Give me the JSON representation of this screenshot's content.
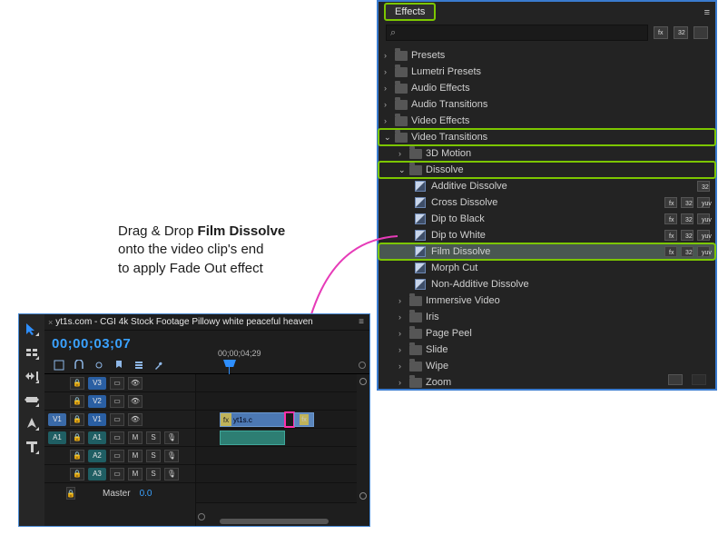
{
  "instruction": {
    "line1_pre": "Drag & Drop ",
    "line1_bold": "Film Dissolve",
    "line2": "onto the video clip's end",
    "line3": "to apply Fade Out effect"
  },
  "effects_panel": {
    "tab_label": "Effects",
    "search_placeholder": "",
    "tree": [
      {
        "type": "folder",
        "label": "Presets",
        "expanded": false,
        "indent": 0,
        "highlight": false,
        "badges": []
      },
      {
        "type": "folder",
        "label": "Lumetri Presets",
        "expanded": false,
        "indent": 0,
        "highlight": false,
        "badges": []
      },
      {
        "type": "folder",
        "label": "Audio Effects",
        "expanded": false,
        "indent": 0,
        "highlight": false,
        "badges": []
      },
      {
        "type": "folder",
        "label": "Audio Transitions",
        "expanded": false,
        "indent": 0,
        "highlight": false,
        "badges": []
      },
      {
        "type": "folder",
        "label": "Video Effects",
        "expanded": false,
        "indent": 0,
        "highlight": false,
        "badges": []
      },
      {
        "type": "folder",
        "label": "Video Transitions",
        "expanded": true,
        "indent": 0,
        "highlight": true,
        "badges": []
      },
      {
        "type": "folder",
        "label": "3D Motion",
        "expanded": false,
        "indent": 1,
        "highlight": false,
        "badges": []
      },
      {
        "type": "folder",
        "label": "Dissolve",
        "expanded": true,
        "indent": 1,
        "highlight": true,
        "badges": []
      },
      {
        "type": "effect",
        "label": "Additive Dissolve",
        "indent": 2,
        "highlight": false,
        "selected": false,
        "badges": [
          "32"
        ]
      },
      {
        "type": "effect",
        "label": "Cross Dissolve",
        "indent": 2,
        "highlight": false,
        "selected": false,
        "badges": [
          "fx",
          "32",
          "yuv"
        ]
      },
      {
        "type": "effect",
        "label": "Dip to Black",
        "indent": 2,
        "highlight": false,
        "selected": false,
        "badges": [
          "fx",
          "32",
          "yuv"
        ]
      },
      {
        "type": "effect",
        "label": "Dip to White",
        "indent": 2,
        "highlight": false,
        "selected": false,
        "badges": [
          "fx",
          "32",
          "yuv"
        ]
      },
      {
        "type": "effect",
        "label": "Film Dissolve",
        "indent": 2,
        "highlight": true,
        "selected": true,
        "badges": [
          "fx",
          "32",
          "yuv"
        ]
      },
      {
        "type": "effect",
        "label": "Morph Cut",
        "indent": 2,
        "highlight": false,
        "selected": false,
        "badges": []
      },
      {
        "type": "effect",
        "label": "Non-Additive Dissolve",
        "indent": 2,
        "highlight": false,
        "selected": false,
        "badges": []
      },
      {
        "type": "folder",
        "label": "Immersive Video",
        "expanded": false,
        "indent": 1,
        "highlight": false,
        "badges": []
      },
      {
        "type": "folder",
        "label": "Iris",
        "expanded": false,
        "indent": 1,
        "highlight": false,
        "badges": []
      },
      {
        "type": "folder",
        "label": "Page Peel",
        "expanded": false,
        "indent": 1,
        "highlight": false,
        "badges": []
      },
      {
        "type": "folder",
        "label": "Slide",
        "expanded": false,
        "indent": 1,
        "highlight": false,
        "badges": []
      },
      {
        "type": "folder",
        "label": "Wipe",
        "expanded": false,
        "indent": 1,
        "highlight": false,
        "badges": []
      },
      {
        "type": "folder",
        "label": "Zoom",
        "expanded": false,
        "indent": 1,
        "highlight": false,
        "badges": []
      }
    ]
  },
  "timeline": {
    "sequence_tab": "yt1s.com - CGI 4k Stock Footage  Pillowy white peaceful heaven",
    "timecode": "00;00;03;07",
    "ruler_mark": "00;00;04;29",
    "tools": [
      "selection",
      "track-select",
      "ripple",
      "razor",
      "slip",
      "pen",
      "hand",
      "type"
    ],
    "option_icons": [
      "nest",
      "snap",
      "linked",
      "markers",
      "settings",
      "wrench"
    ],
    "video_tracks": [
      "V3",
      "V2",
      "V1"
    ],
    "audio_tracks": [
      "A1",
      "A2",
      "A3"
    ],
    "source_v": "V1",
    "source_a": "A1",
    "mute": "M",
    "solo": "S",
    "clip_label": "yt1s.c",
    "fx": "fx",
    "master_label": "Master",
    "master_value": "0.0"
  }
}
